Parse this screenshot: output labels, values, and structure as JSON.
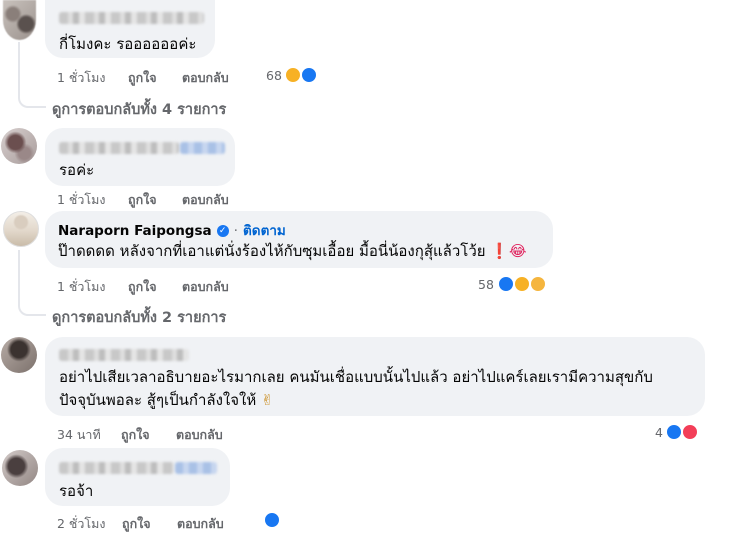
{
  "comments": [
    {
      "text": "กี่โมงคะ รออออออค่ะ",
      "time": "1 ชั่วโมง",
      "like": "ถูกใจ",
      "reply": "ตอบกลับ",
      "reaction_count": "68",
      "reactions": [
        "haha",
        "like"
      ],
      "view_replies": "ดูการตอบกลับทั้ง 4 รายการ"
    },
    {
      "text": "รอค่ะ",
      "time": "1 ชั่วโมง",
      "like": "ถูกใจ",
      "reply": "ตอบกลับ"
    },
    {
      "author": "Naraporn Faipongsa",
      "verified": true,
      "separator": "·",
      "follow": "ติดตาม",
      "text": "ป๊าดดดด หลังจากที่เอาแต่นั่งร้องไห้กับซุมเอื้อย มื้อนี่น้องกุสุ้แล้วโว้ย",
      "emoji": "❗😂",
      "time": "1 ชั่วโมง",
      "like": "ถูกใจ",
      "reply": "ตอบกลับ",
      "reaction_count": "58",
      "reactions": [
        "like",
        "haha",
        "care"
      ],
      "view_replies": "ดูการตอบกลับทั้ง 2 รายการ"
    },
    {
      "text_line1": "อย่าไปเสียเวลาอธิบายอะไรมากเลย คนมันเชื่อแบบนั้นไปแล้ว อย่าไปแคร์เลยเรามีความสุขกับ",
      "text_line2": "ปัจจุบันพอละ สู้ๆเป็นกำลังใจให้",
      "emoji": "✌",
      "time": "34 นาที",
      "like": "ถูกใจ",
      "reply": "ตอบกลับ",
      "reaction_count": "4",
      "reactions": [
        "like",
        "love"
      ]
    },
    {
      "text": "รอจ้า",
      "time": "2 ชั่วโมง",
      "like": "ถูกใจ",
      "reply": "ตอบกลับ",
      "reactions": [
        "like"
      ]
    }
  ],
  "colors": {
    "bubble": "#f0f2f5",
    "meta": "#65676b",
    "like_blue": "#1877f2",
    "follow_blue": "#0064d1"
  }
}
